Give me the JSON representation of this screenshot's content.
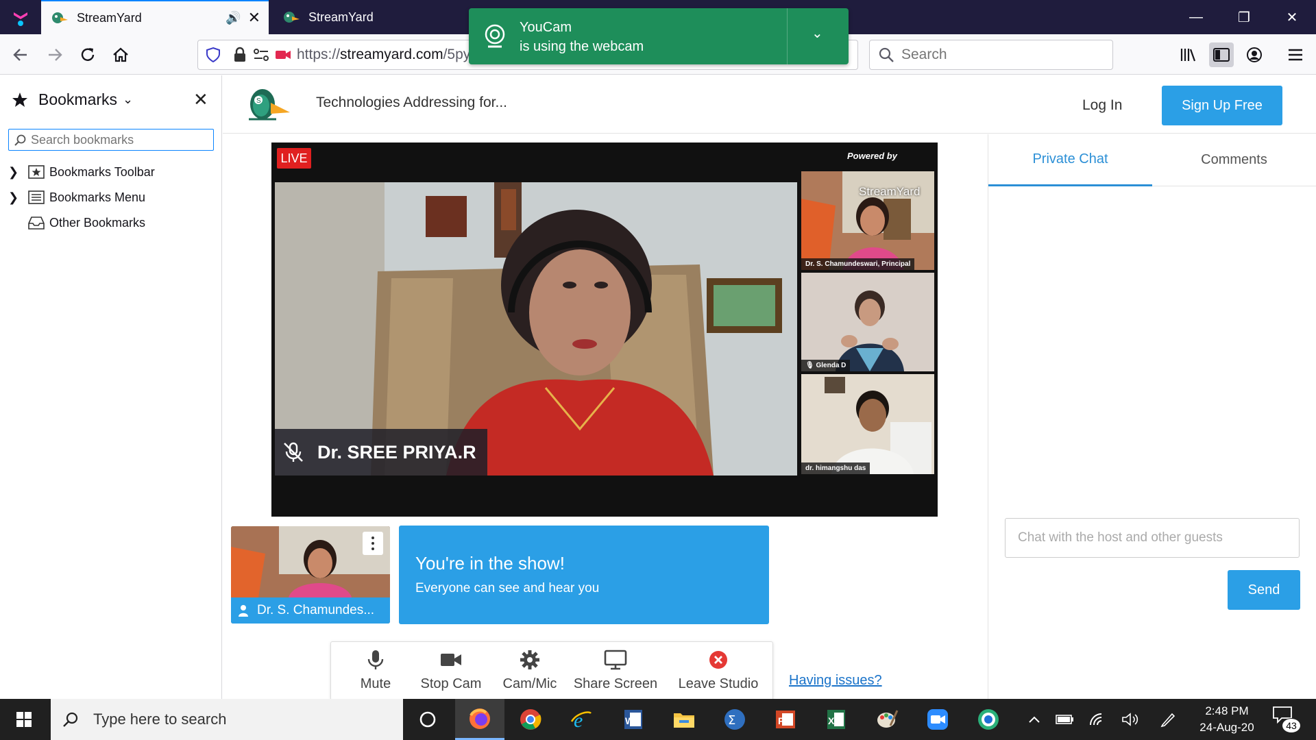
{
  "browser": {
    "tabs": [
      {
        "label": "StreamYard",
        "active": true
      },
      {
        "label": "StreamYard",
        "active": false
      }
    ],
    "url_prefix": "https://",
    "url_host": "streamyard.com",
    "url_path": "/5py",
    "search_placeholder": "Search"
  },
  "notification": {
    "title": "YouCam",
    "subtitle": "is using the webcam"
  },
  "bookmarks": {
    "title": "Bookmarks",
    "search_placeholder": "Search bookmarks",
    "items": [
      {
        "label": "Bookmarks Toolbar",
        "icon": "star-folder-icon",
        "expandable": true
      },
      {
        "label": "Bookmarks Menu",
        "icon": "menu-folder-icon",
        "expandable": true
      },
      {
        "label": "Other Bookmarks",
        "icon": "inbox-folder-icon",
        "expandable": false
      }
    ]
  },
  "streamyard": {
    "title": "Technologies Addressing for...",
    "login_label": "Log In",
    "signup_label": "Sign Up Free",
    "live_badge": "LIVE",
    "powered_by": "Powered by",
    "brand_watermark": "StreamYard",
    "main_speaker": "Dr. SREE PRIYA.R",
    "thumbnails": [
      {
        "name": "Dr. S. Chamundeswari, Principal"
      },
      {
        "name": "Glenda D"
      },
      {
        "name": "dr. himangshu das"
      }
    ],
    "self_name": "Dr. S. Chamundes...",
    "banner_heading": "You're in the show!",
    "banner_sub": "Everyone can see and hear you",
    "controls": [
      {
        "label": "Mute",
        "icon": "microphone-icon"
      },
      {
        "label": "Stop Cam",
        "icon": "camera-icon"
      },
      {
        "label": "Cam/Mic",
        "icon": "gear-icon"
      },
      {
        "label": "Share Screen",
        "icon": "monitor-icon"
      },
      {
        "label": "Leave Studio",
        "icon": "leave-icon"
      }
    ],
    "issues_link": "Having issues?",
    "chat": {
      "tab_private": "Private Chat",
      "tab_comments": "Comments",
      "input_placeholder": "Chat with the host and other guests",
      "send_label": "Send"
    }
  },
  "taskbar": {
    "search_placeholder": "Type here to search",
    "time": "2:48 PM",
    "date": "24-Aug-20",
    "notification_count": "43"
  },
  "colors": {
    "accent": "#2b9fe6",
    "live_red": "#e02020",
    "toast_green": "#1e8e5a",
    "titlebar": "#1f1c3d"
  }
}
